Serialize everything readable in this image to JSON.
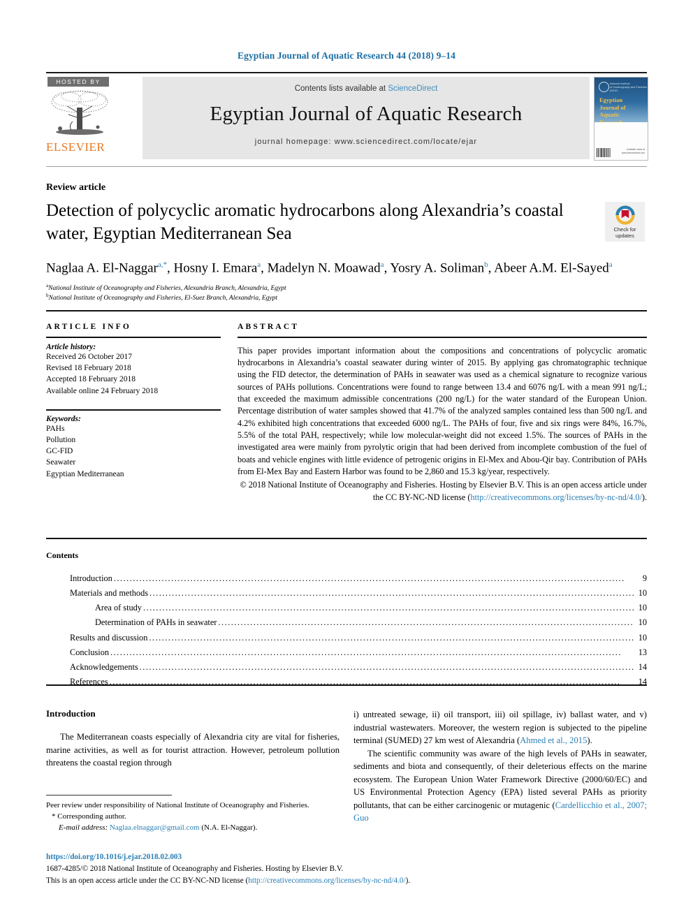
{
  "running_head": "Egyptian Journal of Aquatic Research 44 (2018) 9–14",
  "header": {
    "hosted_by": "HOSTED BY",
    "publisher": "ELSEVIER",
    "contents_prefix": "Contents lists available at ",
    "sciencedirect": "ScienceDirect",
    "journal_title": "Egyptian Journal of Aquatic Research",
    "homepage": "journal homepage: www.sciencedirect.com/locate/ejar",
    "cover": {
      "org_line_1": "National Institute",
      "org_line_2": "of Oceanography and Fisheries (NIOF)",
      "title": "Egyptian Journal of Aquatic Research",
      "foot_line_1": "Available online at",
      "foot_line_2": "www.sciencedirect.com"
    }
  },
  "article": {
    "category": "Review article",
    "title": "Detection of polycyclic aromatic hydrocarbons along Alexandria’s coastal water, Egyptian Mediterranean Sea",
    "crossmark": {
      "line1": "Check for",
      "line2": "updates"
    },
    "authors": [
      {
        "name": "Naglaa A. El-Naggar",
        "sup": "a,*"
      },
      {
        "name": "Hosny I. Emara",
        "sup": "a"
      },
      {
        "name": "Madelyn N. Moawad",
        "sup": "a"
      },
      {
        "name": "Yosry A. Soliman",
        "sup": "b"
      },
      {
        "name": "Abeer A.M. El-Sayed",
        "sup": "a"
      }
    ],
    "affiliations": [
      {
        "sup": "a",
        "text": "National Institute of Oceanography and Fisheries, Alexandria Branch, Alexandria, Egypt"
      },
      {
        "sup": "b",
        "text": "National Institute of Oceanography and Fisheries, El-Suez Branch, Alexandria, Egypt"
      }
    ]
  },
  "article_info": {
    "heading": "ARTICLE INFO",
    "history_label": "Article history:",
    "history": [
      "Received 26 October 2017",
      "Revised 18 February 2018",
      "Accepted 18 February 2018",
      "Available online 24 February 2018"
    ],
    "keywords_label": "Keywords:",
    "keywords": [
      "PAHs",
      "Pollution",
      "GC-FID",
      "Seawater",
      "Egyptian Mediterranean"
    ]
  },
  "abstract": {
    "heading": "ABSTRACT",
    "body": "This paper provides important information about the compositions and concentrations of polycyclic aromatic hydrocarbons in Alexandria’s coastal seawater during winter of 2015. By applying gas chromatographic technique using the FID detector, the determination of PAHs in seawater was used as a chemical signature to recognize various sources of PAHs pollutions. Concentrations were found to range between 13.4 and 6076 ng/L with a mean 991 ng/L; that exceeded the maximum admissible concentrations (200 ng/L) for the water standard of the European Union. Percentage distribution of water samples showed that 41.7% of the analyzed samples contained less than 500 ng/L and 4.2% exhibited high concentrations that exceeded 6000 ng/L. The PAHs of four, five and six rings were 84%, 16.7%, 5.5% of the total PAH, respectively; while low molecular-weight did not exceed 1.5%. The sources of PAHs in the investigated area were mainly from pyrolytic origin that had been derived from incomplete combustion of the fuel of boats and vehicle engines with little evidence of petrogenic origins in El-Mex and Abou-Qir bay. Contribution of PAHs from El-Mex Bay and Eastern Harbor was found to be 2,860 and 15.3 kg/year, respectively.",
    "copyright_pre": "© 2018 National Institute of Oceanography and Fisheries. Hosting by Elsevier B.V. This is an open access article under the CC BY-NC-ND license (",
    "copyright_link": "http://creativecommons.org/licenses/by-nc-nd/4.0/",
    "copyright_post": ")."
  },
  "contents": {
    "heading": "Contents",
    "items": [
      {
        "label": "Introduction",
        "page": "9",
        "indent": false
      },
      {
        "label": "Materials and methods",
        "page": "10",
        "indent": false
      },
      {
        "label": "Area of study",
        "page": "10",
        "indent": true
      },
      {
        "label": "Determination of PAHs in seawater",
        "page": "10",
        "indent": true
      },
      {
        "label": "Results and discussion",
        "page": "10",
        "indent": false
      },
      {
        "label": "Conclusion",
        "page": "13",
        "indent": false
      },
      {
        "label": "Acknowledgements",
        "page": "14",
        "indent": false
      },
      {
        "label": "References",
        "page": "14",
        "indent": false
      }
    ],
    "leader": "................................................................................................................................................................"
  },
  "body": {
    "intro_heading": "Introduction",
    "left_p1": "The Mediterranean coasts especially of Alexandria city are vital for fisheries, marine activities, as well as for tourist attraction. However, petroleum pollution threatens the coastal region through",
    "right_p1_a": "i) untreated sewage, ii) oil transport, iii) oil spillage, iv) ballast water, and v) industrial wastewaters. Moreover, the western region is subjected to the pipeline terminal (SUMED) 27 km west of Alexandria (",
    "right_p1_cite": "Ahmed et al., 2015",
    "right_p1_b": ").",
    "right_p2_a": "The scientific community was aware of the high levels of PAHs in seawater, sediments and biota and consequently, of their deleterious effects on the marine ecosystem. The European Union Water Framework Directive (2000/60/EC) and US Environmental Protection Agency (EPA) listed several PAHs as priority pollutants, that can be either carcinogenic or mutagenic (",
    "right_p2_cite": "Cardellicchio et al., 2007; Guo"
  },
  "footnote": {
    "peer_review": "Peer review under responsibility of National Institute of Oceanography and Fisheries.",
    "corresponding": "* Corresponding author.",
    "email_label": "E-mail address:",
    "email": "Naglaa.elnaggar@gmail.com",
    "email_suffix": "(N.A. El-Naggar)."
  },
  "bottom": {
    "doi": "https://doi.org/10.1016/j.ejar.2018.02.003",
    "issn_line": "1687-4285/© 2018 National Institute of Oceanography and Fisheries. Hosting by Elsevier B.V.",
    "license_pre": "This is an open access article under the CC BY-NC-ND license (",
    "license_link": "http://creativecommons.org/licenses/by-nc-nd/4.0/",
    "license_post": ")."
  },
  "colors": {
    "link_blue": "#2a7fb4",
    "sciencedirect_blue": "#3d8dbe",
    "elsevier_orange": "#e87722",
    "header_band": "#e6e6e6"
  }
}
